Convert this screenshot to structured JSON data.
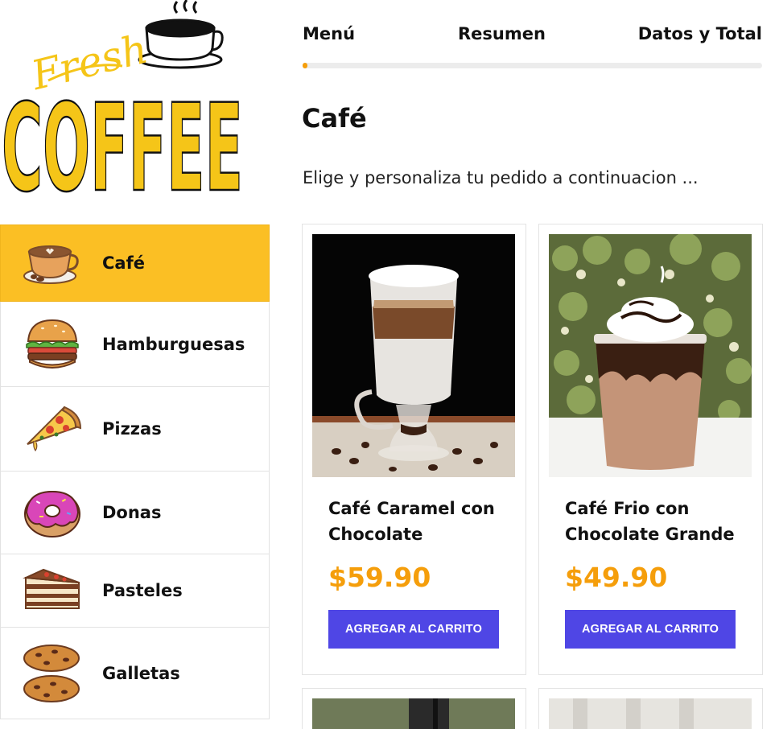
{
  "brand": {
    "logo_top_text": "Fresh",
    "logo_main_text": "COFFEE",
    "logo_color": "#f5c518"
  },
  "steps": {
    "items": [
      "Menú",
      "Resumen",
      "Datos y Total"
    ],
    "progress_percent": 1
  },
  "main": {
    "title": "Café",
    "subtitle": "Elige y personaliza tu pedido a continuacion ..."
  },
  "sidebar": {
    "items": [
      {
        "label": "Café",
        "icon": "coffee-cup-icon",
        "active": true
      },
      {
        "label": "Hamburguesas",
        "icon": "burger-icon",
        "active": false
      },
      {
        "label": "Pizzas",
        "icon": "pizza-icon",
        "active": false
      },
      {
        "label": "Donas",
        "icon": "donut-icon",
        "active": false
      },
      {
        "label": "Pasteles",
        "icon": "cake-icon",
        "active": false
      },
      {
        "label": "Galletas",
        "icon": "cookie-icon",
        "active": false
      }
    ]
  },
  "products": [
    {
      "name": "Café Caramel con Chocolate",
      "price": "$59.90",
      "button": "AGREGAR AL CARRITO"
    },
    {
      "name": "Café Frio con Chocolate Grande",
      "price": "$49.90",
      "button": "AGREGAR AL CARRITO"
    }
  ],
  "colors": {
    "accent": "#fbbf24",
    "price": "#f59e0b",
    "button": "#4f46e5"
  }
}
